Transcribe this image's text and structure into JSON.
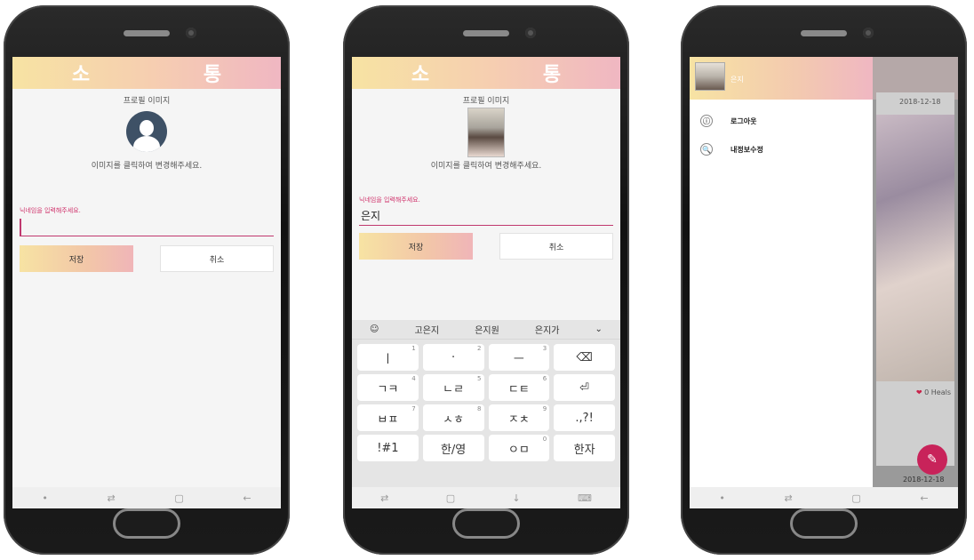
{
  "screen1": {
    "title": "소 통",
    "profile_label": "프로필 이미지",
    "image_hint": "이미지를 클릭하여 변경해주세요.",
    "nickname_label": "닉네임을 입력해주세요.",
    "nickname_value": "",
    "save_label": "저장",
    "cancel_label": "취소"
  },
  "screen2": {
    "title": "소 통",
    "profile_label": "프로필 이미지",
    "image_hint": "이미지를 클릭하여 변경해주세요.",
    "nickname_label": "닉네임을 입력해주세요.",
    "nickname_value": "은지",
    "save_label": "저장",
    "cancel_label": "취소",
    "suggestions": [
      "고은지",
      "은지원",
      "은지가"
    ],
    "keys": [
      {
        "label": "ㅣ",
        "num": "1"
      },
      {
        "label": "·",
        "num": "2"
      },
      {
        "label": "ㅡ",
        "num": "3"
      },
      {
        "label": "⌫",
        "num": ""
      },
      {
        "label": "ㄱㅋ",
        "num": "4"
      },
      {
        "label": "ㄴㄹ",
        "num": "5"
      },
      {
        "label": "ㄷㅌ",
        "num": "6"
      },
      {
        "label": "⏎",
        "num": ""
      },
      {
        "label": "ㅂㅍ",
        "num": "7"
      },
      {
        "label": "ㅅㅎ",
        "num": "8"
      },
      {
        "label": "ㅈㅊ",
        "num": "9"
      },
      {
        "label": ".,?!",
        "num": ""
      },
      {
        "label": "!#1",
        "num": ""
      },
      {
        "label": "한/영",
        "num": ""
      },
      {
        "label": "ㅇㅁ",
        "num": "0"
      },
      {
        "label": "한자",
        "num": ""
      }
    ]
  },
  "screen3": {
    "user_name": "은지",
    "menu": [
      {
        "label": "로그아웃",
        "icon": "ⓘ"
      },
      {
        "label": "내정보수정",
        "icon": "🔍"
      }
    ],
    "post_date": "2018-12-18",
    "hearts_label": "0 Heals",
    "post_date2": "2018-12-18"
  }
}
